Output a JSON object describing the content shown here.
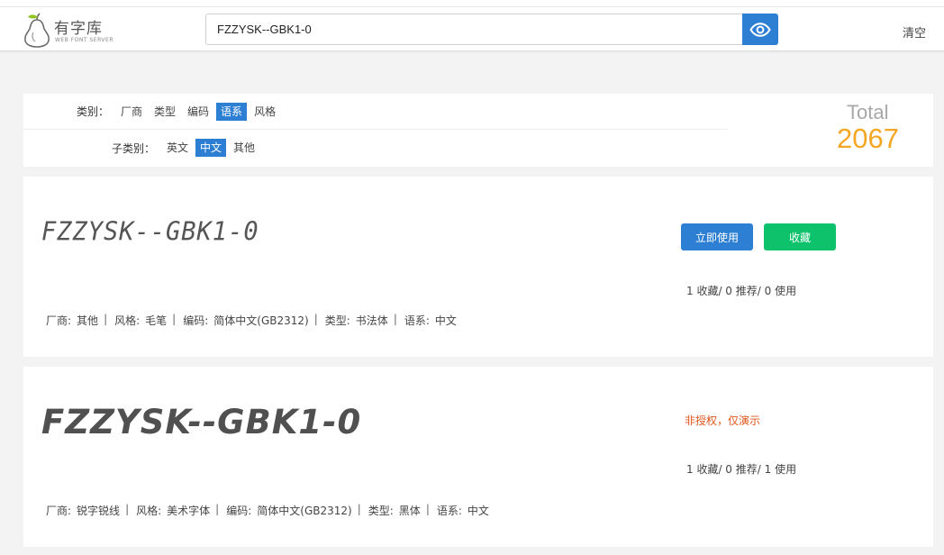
{
  "header": {
    "logo_title": "有字库",
    "logo_subtitle": "WEB FONT SERVER",
    "search_value": "FZZYSK--GBK1-0",
    "clear_label": "清空"
  },
  "filters": {
    "category_label": "类别：",
    "categories": [
      "厂商",
      "类型",
      "编码",
      "语系",
      "风格"
    ],
    "category_active": "语系",
    "subcategory_label": "子类别：",
    "subcategories": [
      "英文",
      "中文",
      "其他"
    ],
    "subcategory_active": "中文"
  },
  "total": {
    "label": "Total",
    "count": "2067"
  },
  "fonts": [
    {
      "preview": "FZZYSK--GBK1-0",
      "use_label": "立即使用",
      "fav_label": "收藏",
      "stats": "1 收藏/ 0 推荐/ 0 使用",
      "meta": {
        "vendor_k": "厂商:",
        "vendor_v": "其他",
        "style_k": "风格:",
        "style_v": "毛笔",
        "enc_k": "编码:",
        "enc_v": "简体中文(GB2312)",
        "type_k": "类型:",
        "type_v": "书法体",
        "lang_k": "语系:",
        "lang_v": "中文"
      }
    },
    {
      "preview": "FZZYSK--GBK1-0",
      "notice": "非授权，仅演示",
      "stats": "1 收藏/ 0 推荐/ 1 使用",
      "meta": {
        "vendor_k": "厂商:",
        "vendor_v": "锐字锐线",
        "style_k": "风格:",
        "style_v": "美术字体",
        "enc_k": "编码:",
        "enc_v": "简体中文(GB2312)",
        "type_k": "类型:",
        "type_v": "黑体",
        "lang_k": "语系:",
        "lang_v": "中文"
      }
    }
  ],
  "colors": {
    "primary": "#2d7fd3",
    "success": "#0ec26b",
    "total": "#f5a623",
    "warning_text": "#e0561b"
  },
  "icons": {
    "logo": "pear-logo-icon",
    "search_button": "eye-icon"
  }
}
